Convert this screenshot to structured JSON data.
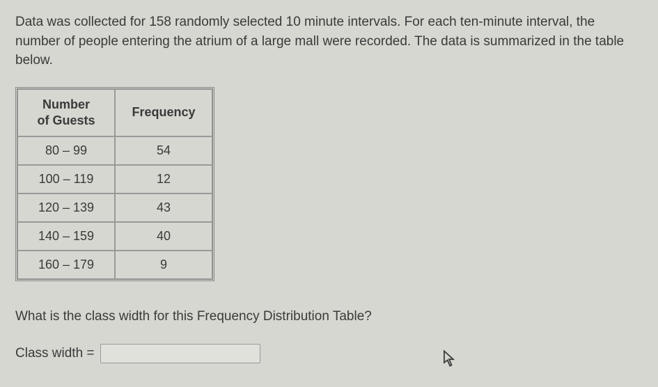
{
  "problem": {
    "text": "Data was collected for 158 randomly selected 10 minute intervals. For each ten-minute interval, the number of people entering the atrium of a large mall were recorded. The data is summarized in the table below."
  },
  "table": {
    "header_col1_line1": "Number",
    "header_col1_line2": "of Guests",
    "header_col2": "Frequency",
    "rows": [
      {
        "range": "80 – 99",
        "freq": "54"
      },
      {
        "range": "100 – 119",
        "freq": "12"
      },
      {
        "range": "120 – 139",
        "freq": "43"
      },
      {
        "range": "140 – 159",
        "freq": "40"
      },
      {
        "range": "160 – 179",
        "freq": "9"
      }
    ]
  },
  "question": {
    "text": "What is the class width for this Frequency Distribution Table?"
  },
  "answer": {
    "label": "Class width =",
    "value": ""
  }
}
